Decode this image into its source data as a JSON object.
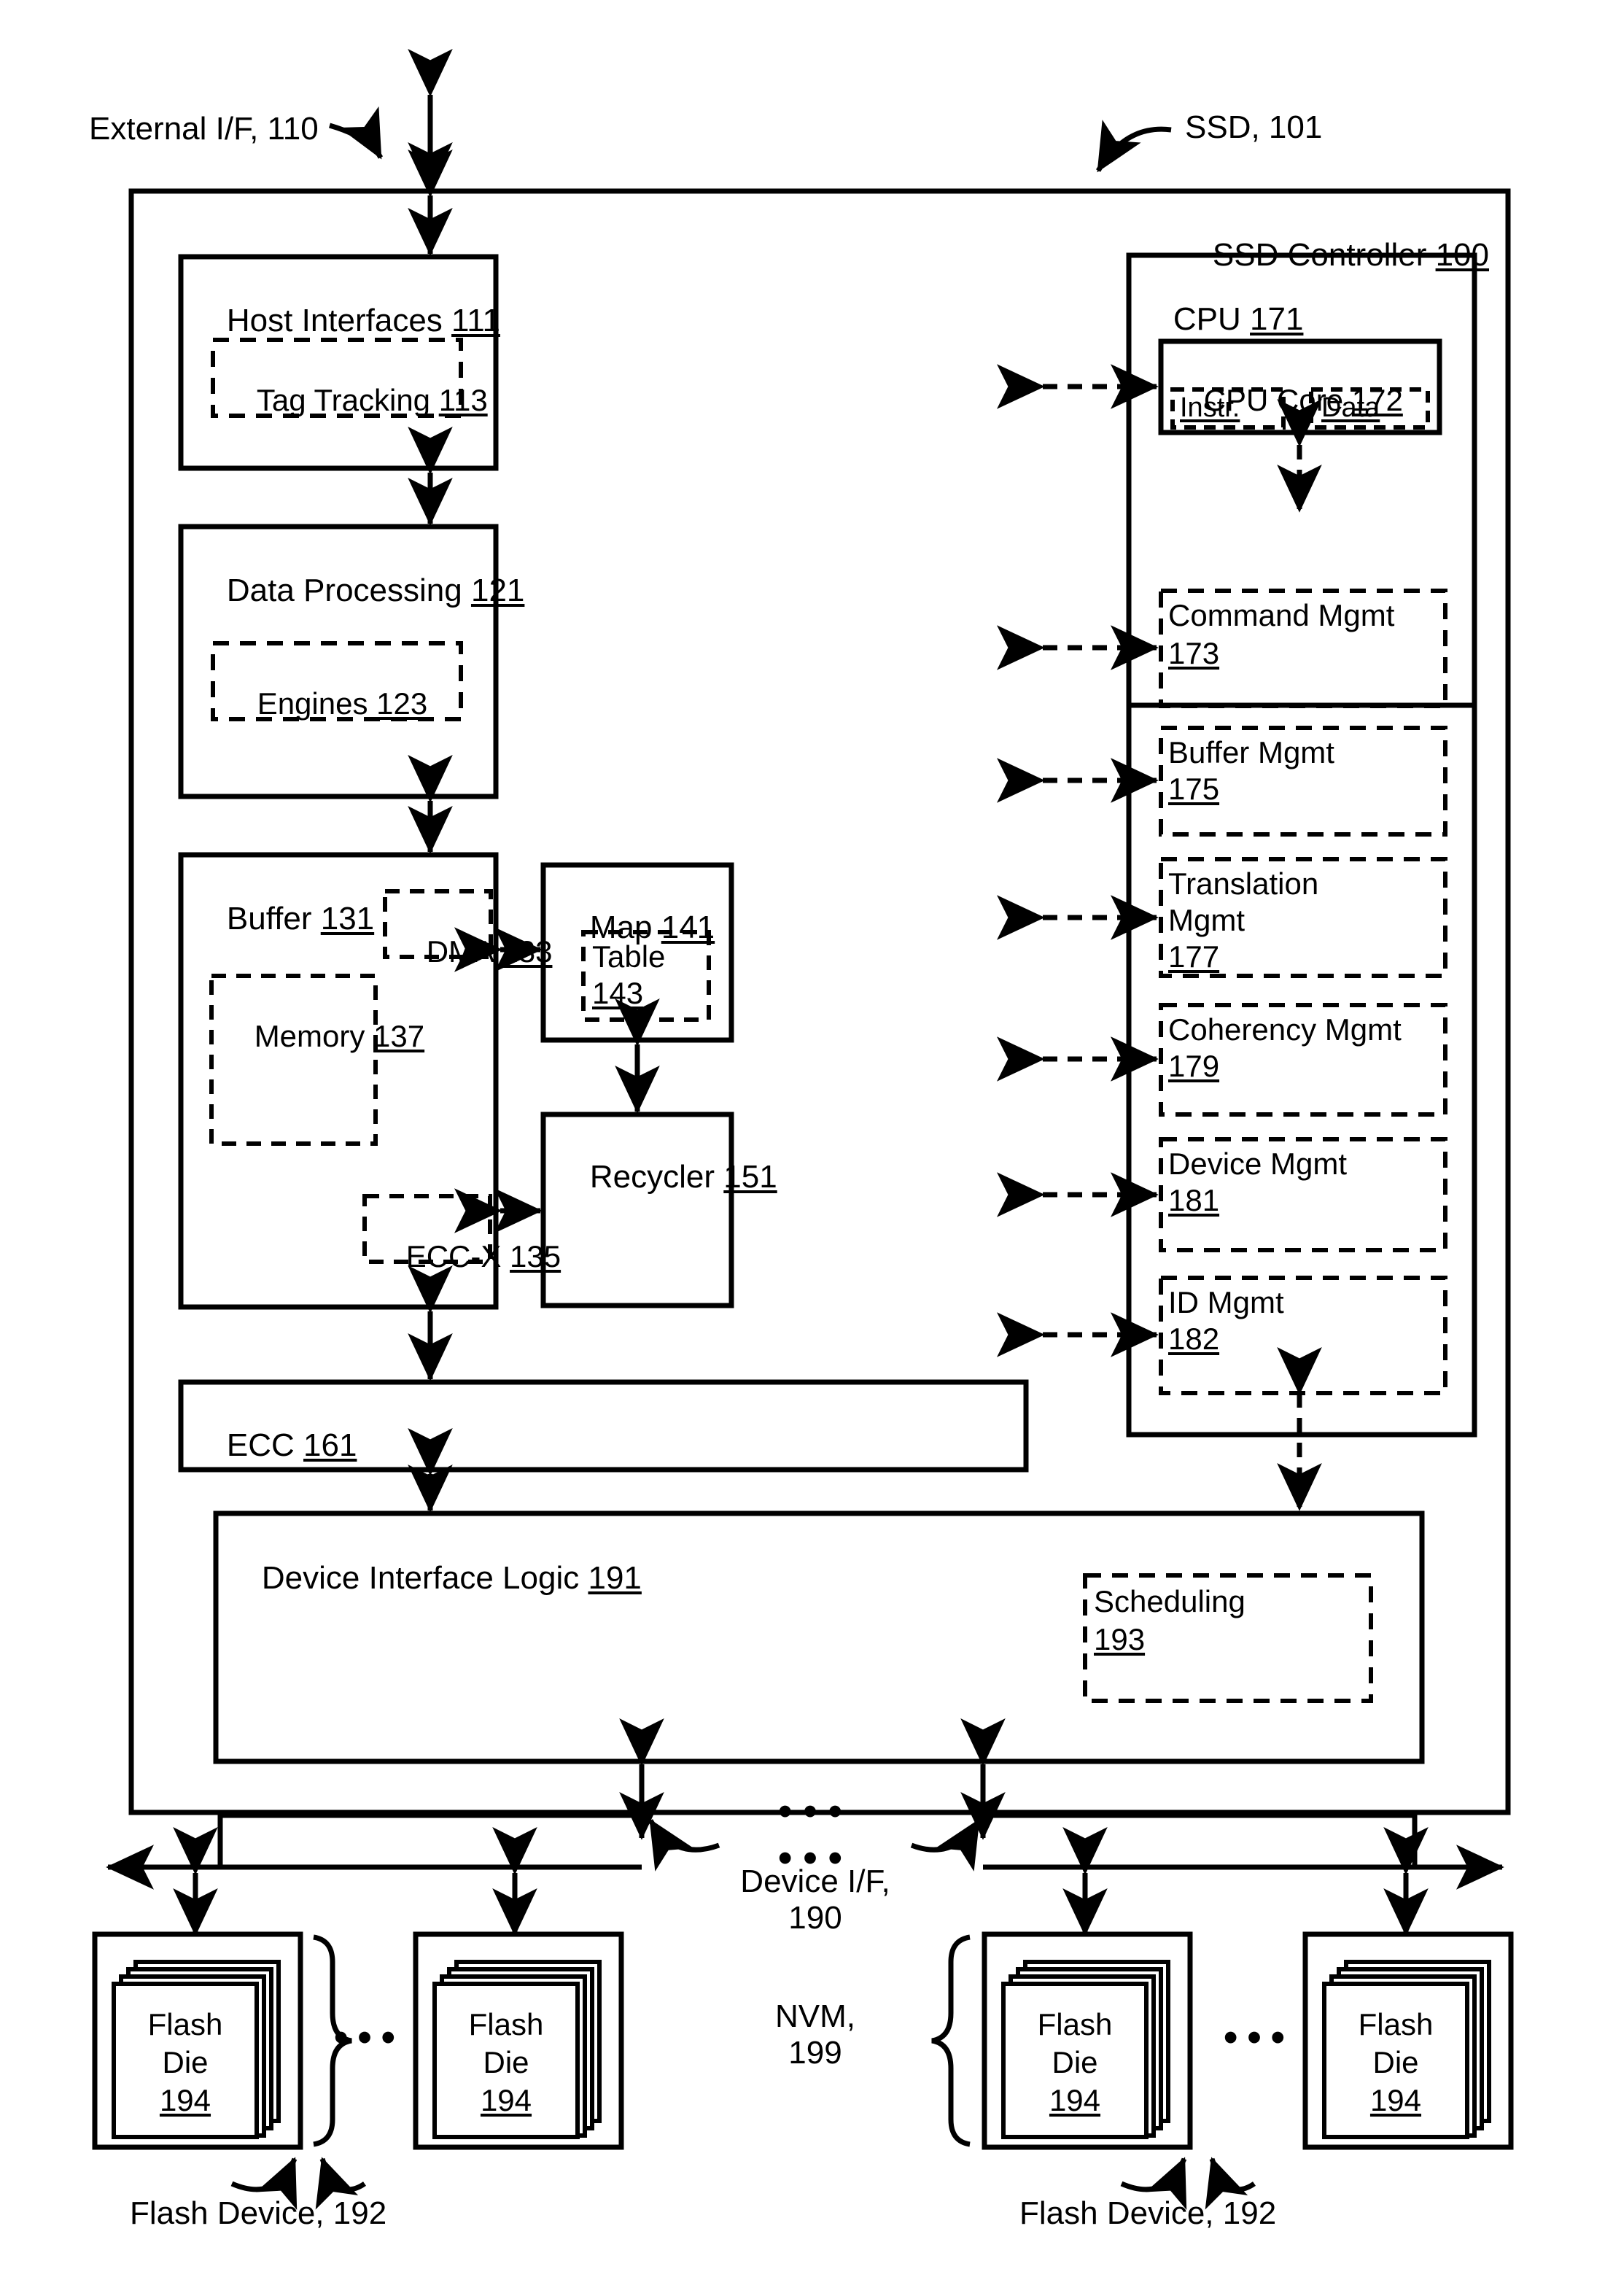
{
  "figure": {
    "kind": "patent-block-diagram",
    "subject": "SSD Controller architecture"
  },
  "callouts": {
    "external_if": "External I/F, 110",
    "ssd": "SSD, 101",
    "device_if_line1": "Device I/F,",
    "device_if_line2": "190",
    "nvm_line1": "NVM,",
    "nvm_line2": "199",
    "flash_device_left": "Flash Device, 192",
    "flash_device_right": "Flash Device, 192"
  },
  "controller": {
    "title_text": "SSD Controller ",
    "title_ref": "100"
  },
  "blocks": {
    "host_interfaces": {
      "text": "Host Interfaces ",
      "ref": "111"
    },
    "tag_tracking": {
      "text": "Tag Tracking ",
      "ref": "113"
    },
    "data_processing": {
      "text": "Data Processing ",
      "ref": "121"
    },
    "engines": {
      "text": "Engines ",
      "ref": "123"
    },
    "buffer": {
      "text": "Buffer ",
      "ref": "131"
    },
    "dma": {
      "text": "DMA ",
      "ref": "133"
    },
    "memory": {
      "text": "Memory ",
      "ref": "137"
    },
    "eccx": {
      "text": "ECC-X ",
      "ref": "135"
    },
    "map": {
      "text": "Map ",
      "ref": "141"
    },
    "table": {
      "text": "Table",
      "ref": "143"
    },
    "recycler": {
      "text": "Recycler ",
      "ref": "151"
    },
    "ecc": {
      "text": "ECC ",
      "ref": "161"
    },
    "device_interface_logic": {
      "text": "Device Interface Logic ",
      "ref": "191"
    },
    "scheduling": {
      "text": "Scheduling",
      "ref": "193"
    }
  },
  "cpu": {
    "title_text": "CPU ",
    "title_ref": "171",
    "core": {
      "text": "CPU Core ",
      "ref": "172"
    },
    "core_sub": [
      {
        "label": "Instr."
      },
      {
        "label": "Data"
      }
    ],
    "managers": [
      {
        "text": "Command Mgmt",
        "ref": "173",
        "lines": 1
      },
      {
        "text": "Buffer Mgmt",
        "ref": "175",
        "lines": 1
      },
      {
        "text": "Translation",
        "text2": "Mgmt",
        "ref": "177",
        "lines": 2
      },
      {
        "text": "Coherency Mgmt",
        "ref": "179",
        "lines": 1
      },
      {
        "text": "Device Mgmt",
        "ref": "181",
        "lines": 1
      },
      {
        "text": "ID Mgmt",
        "ref": "182",
        "lines": 1
      }
    ]
  },
  "flash": {
    "die_text_line1": "Flash",
    "die_text_line2": "Die",
    "die_ref": "194",
    "groups": [
      {
        "side": "left",
        "dies": 2,
        "ellipsis": "•••",
        "brace": "right"
      },
      {
        "side": "right",
        "dies": 2,
        "ellipsis": "•••",
        "brace": "left"
      }
    ]
  },
  "ellipsis": {
    "bus_top": "•••",
    "bus_bottom": "•••",
    "dies_left": "•••",
    "dies_right": "•••"
  },
  "colors": {
    "ink": "#000000",
    "paper": "#ffffff"
  }
}
